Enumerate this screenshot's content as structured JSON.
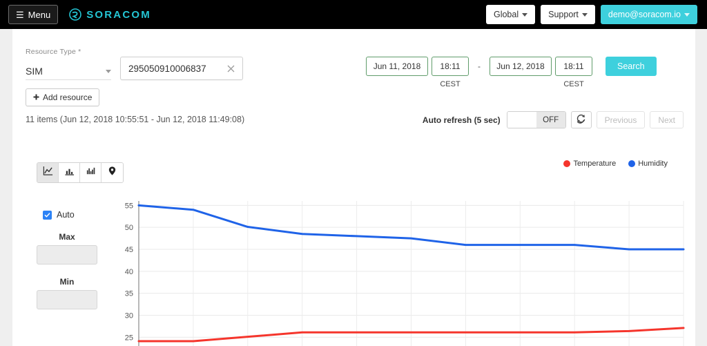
{
  "topbar": {
    "menu_label": "Menu",
    "burger_icon": "hamburger-icon",
    "brand": "SORACOM",
    "brand_color": "#24c5d4",
    "global_label": "Global",
    "support_label": "Support",
    "account_label": "demo@soracom.io",
    "accent_color": "#3ed0dd"
  },
  "filters": {
    "resource_type_label": "Resource Type *",
    "resource_type_value": "SIM",
    "resource_id_value": "295050910006837",
    "resource_id_placeholder": "",
    "clear_icon": "close-icon",
    "add_resource_label": "Add resource",
    "add_icon": "plus-icon",
    "date_from": "Jun 11, 2018",
    "time_from": "18:11",
    "tz_from": "CEST",
    "range_separator": "-",
    "date_to": "Jun 12, 2018",
    "time_to": "18:11",
    "tz_to": "CEST",
    "search_label": "Search",
    "date_border_color": "#5f9c6a"
  },
  "summary": {
    "items_text": "11 items (Jun 12, 2018 10:55:51 - Jun 12, 2018 11:49:08)",
    "auto_refresh_label": "Auto refresh (5 sec)",
    "auto_refresh_state": "OFF",
    "refresh_icon": "refresh-icon",
    "previous_label": "Previous",
    "next_label": "Next"
  },
  "view_toggle": [
    {
      "name": "line-chart-icon",
      "active": true
    },
    {
      "name": "bar-chart-icon",
      "active": false
    },
    {
      "name": "column-chart-icon",
      "active": false
    },
    {
      "name": "map-pin-icon",
      "active": false
    }
  ],
  "chart_controls": {
    "auto_label": "Auto",
    "auto_checked": true,
    "checkbox_color": "#2b82f6",
    "max_label": "Max",
    "max_value": "",
    "min_label": "Min",
    "min_value": ""
  },
  "chart_data": {
    "type": "line",
    "title": "",
    "xlabel": "",
    "ylabel": "",
    "ylim": [
      23,
      56
    ],
    "yticks": [
      55,
      50,
      45,
      40,
      35,
      30,
      25
    ],
    "grid": true,
    "legend_position": "top-right",
    "x": [
      0,
      1,
      2,
      3,
      4,
      5,
      6,
      7,
      8,
      9,
      10
    ],
    "series": [
      {
        "name": "Temperature",
        "color": "#f5352c",
        "values": [
          24.1,
          24.1,
          25.1,
          26.1,
          26.1,
          26.1,
          26.1,
          26.1,
          26.1,
          26.4,
          27.1
        ]
      },
      {
        "name": "Humidity",
        "color": "#1f63e8",
        "values": [
          55.0,
          54.0,
          50.1,
          48.5,
          48.0,
          47.5,
          46.0,
          46.0,
          46.0,
          45.0,
          45.0
        ]
      }
    ]
  }
}
